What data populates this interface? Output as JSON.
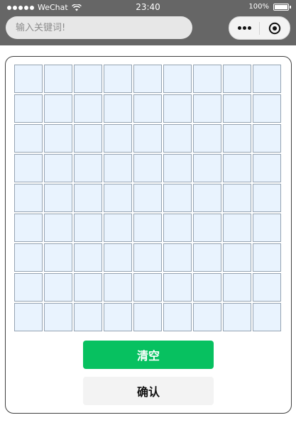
{
  "status_bar": {
    "carrier": "WeChat",
    "time": "23:40",
    "battery_level": "100%",
    "signal_icon": "signal-dots-icon",
    "wifi_icon": "wifi-icon",
    "battery_icon": "battery-icon"
  },
  "nav": {
    "search_placeholder": "输入关键词!",
    "more_icon": "more-dots-icon",
    "close_icon": "target-circle-icon"
  },
  "grid": {
    "rows": 9,
    "cols": 9,
    "cell_color": "#e9f3fe",
    "cell_border_color": "#95a3b2"
  },
  "actions": {
    "clear_label": "清空",
    "confirm_label": "确认",
    "clear_color": "#07c160",
    "confirm_color": "#f3f3f3"
  },
  "colors": {
    "topbar_bg": "#666666"
  }
}
